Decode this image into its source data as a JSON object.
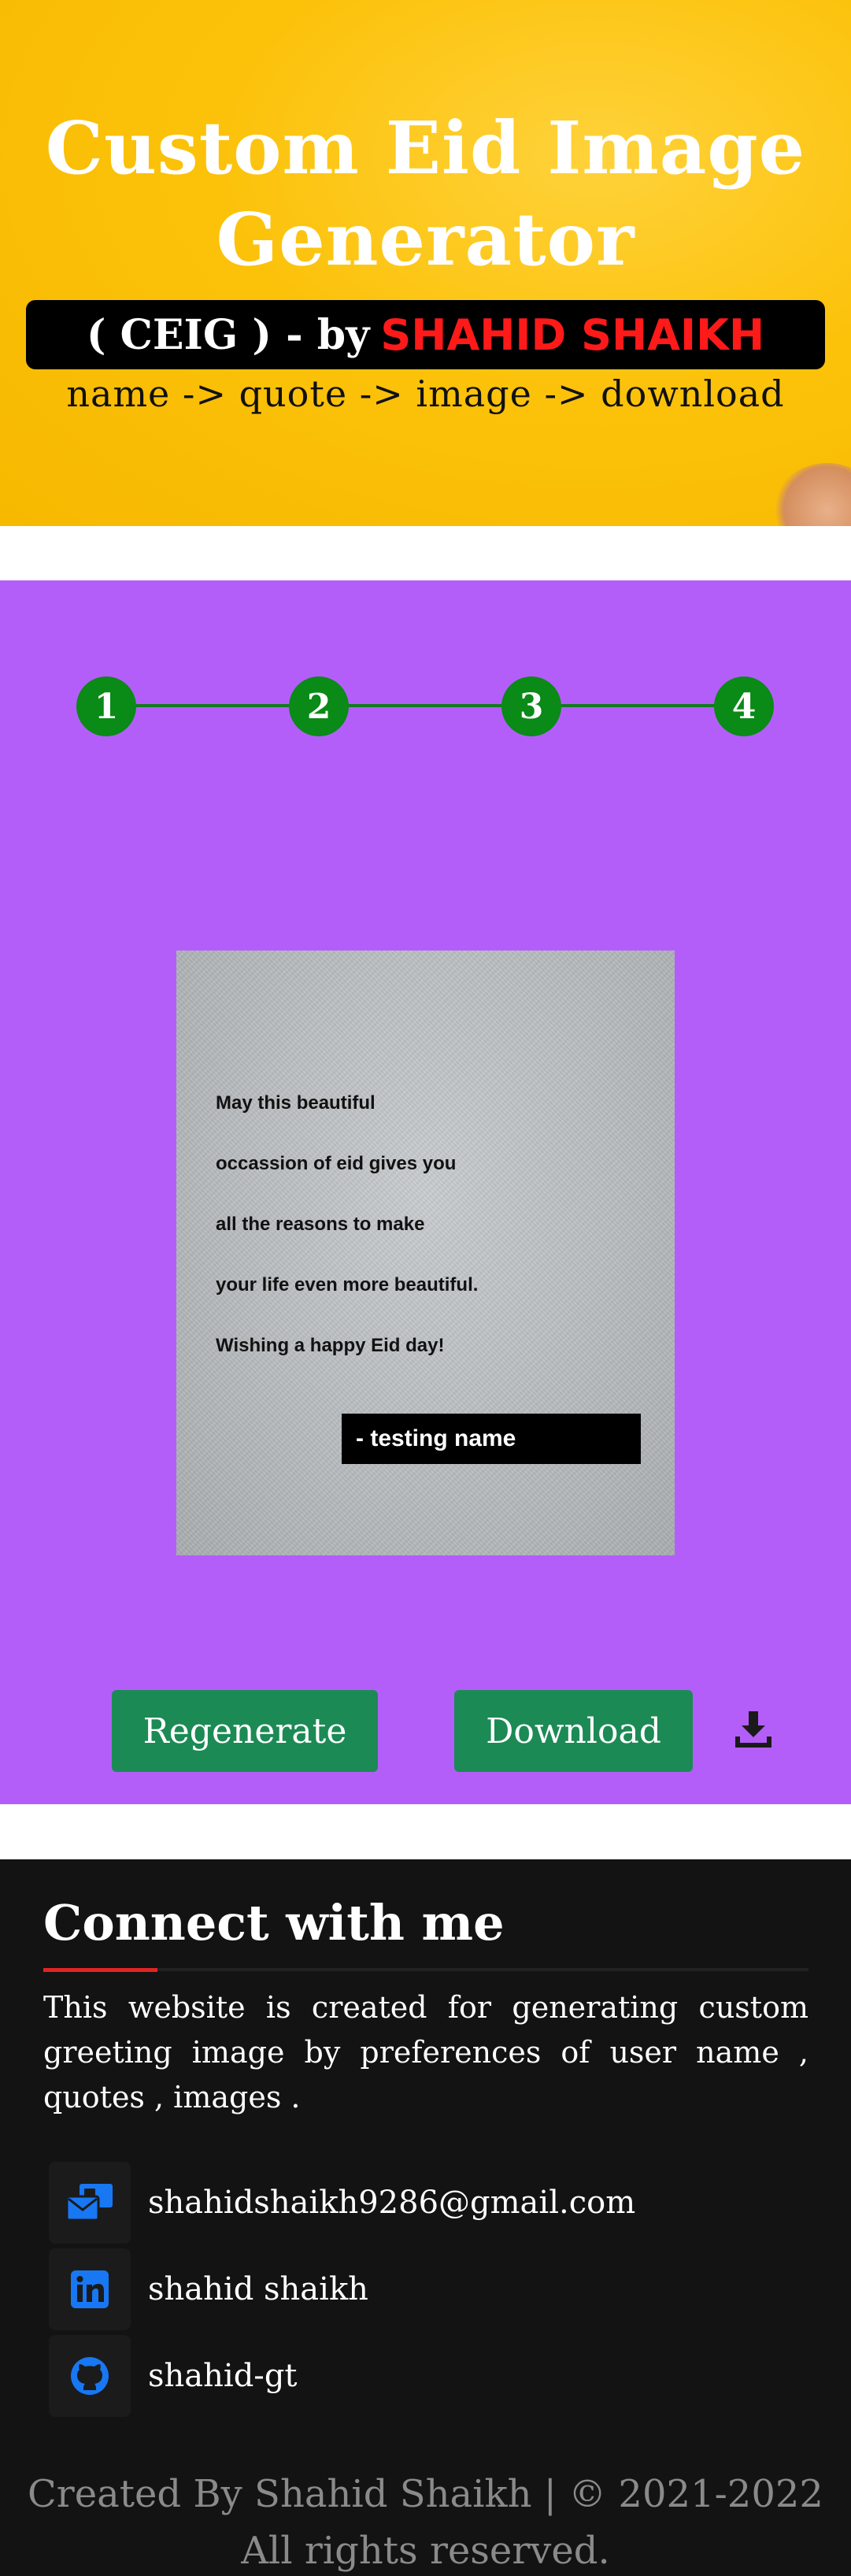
{
  "hero": {
    "title_line1": "Custom Eid Image",
    "title_line2": "Generator",
    "banner_prefix": "( CEIG ) - by",
    "banner_author": "SHAHID SHAIKH",
    "steps_text": "name -> quote -> image -> download"
  },
  "stepper": {
    "steps": [
      "1",
      "2",
      "3",
      "4"
    ],
    "active_color": "#0a8a17"
  },
  "card": {
    "quote_lines": [
      "May this beautiful",
      "occassion of eid gives you",
      "all the reasons to make",
      "your life even more beautiful.",
      "Wishing a happy Eid day!"
    ],
    "signature": "-  testing name"
  },
  "actions": {
    "regenerate_label": "Regenerate",
    "download_label": "Download",
    "download_icon": "download-tray-icon"
  },
  "footer": {
    "title": "Connect with me",
    "description": "This website is created for generating custom greeting image by preferences of user name , quotes , images .",
    "contacts": [
      {
        "icon": "email-icon",
        "label": "shahidshaikh9286@gmail.com"
      },
      {
        "icon": "linkedin-icon",
        "label": "shahid shaikh"
      },
      {
        "icon": "github-icon",
        "label": "shahid-gt"
      }
    ],
    "copyright_line1": "Created By Shahid Shaikh | © 2021-2022",
    "copyright_line2": "All rights reserved."
  },
  "colors": {
    "hero_bg": "#fcc20a",
    "main_bg": "#b45ef9",
    "button_bg": "#1c8a55",
    "footer_bg": "#131313",
    "accent_red": "#e02424",
    "icon_blue": "#1877f2"
  }
}
